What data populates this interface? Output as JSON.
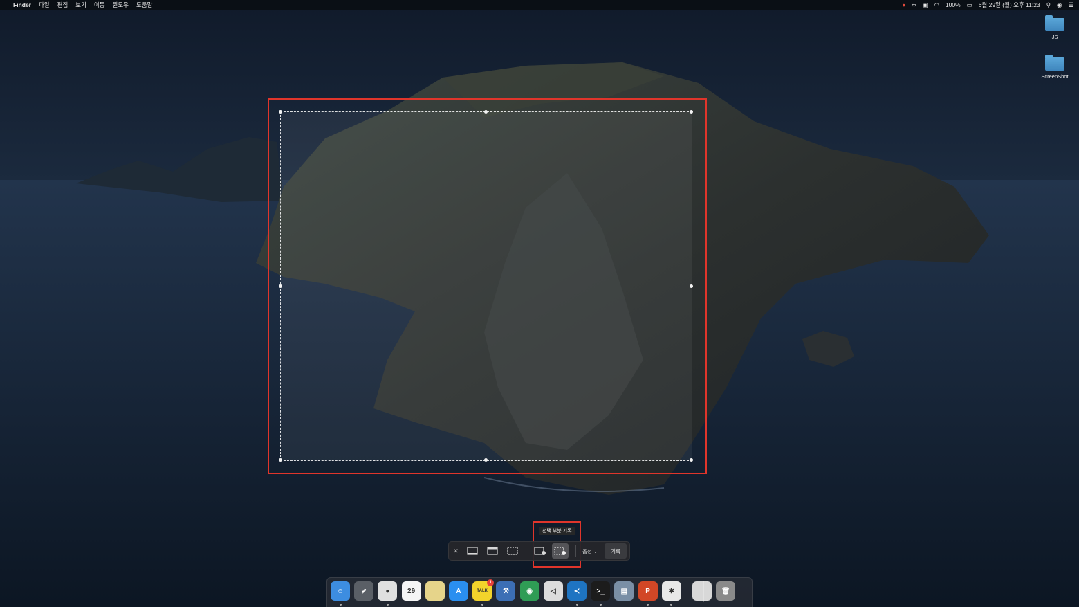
{
  "menubar": {
    "apple": "",
    "app_name": "Finder",
    "menus": [
      "파일",
      "편집",
      "보기",
      "이동",
      "윈도우",
      "도움말"
    ],
    "battery": "100%",
    "datetime": "6월 29일 (월) 오후 11:23"
  },
  "desktop": {
    "items": [
      {
        "label": "JS",
        "icon": "folder-icon"
      },
      {
        "label": "ScreenShot",
        "icon": "folder-icon"
      }
    ]
  },
  "capture_toolbar": {
    "tooltip": "선택 부분 기록",
    "options_label": "옵션",
    "record_label": "기록",
    "selected_mode": "record-selected-portion"
  },
  "dock": {
    "apps": [
      {
        "name": "finder",
        "glyph": "☺",
        "color": "#3d8de0"
      },
      {
        "name": "launchpad",
        "glyph": "➶",
        "color": "#5a5f66"
      },
      {
        "name": "chrome",
        "glyph": "●",
        "color": "#e0e0e0"
      },
      {
        "name": "calendar",
        "glyph": "29",
        "color": "#f5f5f5"
      },
      {
        "name": "notes",
        "glyph": "",
        "color": "#e6d48a"
      },
      {
        "name": "app-store",
        "glyph": "A",
        "color": "#2a8ff0"
      },
      {
        "name": "kakaotalk",
        "glyph": "TALK",
        "color": "#f2d32b",
        "badge": "1"
      },
      {
        "name": "xcode",
        "glyph": "⚒",
        "color": "#3c6fb5"
      },
      {
        "name": "sourcetree",
        "glyph": "◉",
        "color": "#2f9c55"
      },
      {
        "name": "unity",
        "glyph": "◁",
        "color": "#dcdcdc"
      },
      {
        "name": "vscode",
        "glyph": "≺",
        "color": "#1e74c2"
      },
      {
        "name": "terminal",
        "glyph": ">_",
        "color": "#1c1c1c"
      },
      {
        "name": "preview",
        "glyph": "▤",
        "color": "#7a8fa6"
      },
      {
        "name": "powerpoint",
        "glyph": "P",
        "color": "#d24726"
      },
      {
        "name": "slack",
        "glyph": "✱",
        "color": "#e8e8e8"
      },
      {
        "name": "documents",
        "glyph": "",
        "color": "#d8d8d8"
      },
      {
        "name": "trash",
        "glyph": "🗑",
        "color": "#8a8a8a"
      }
    ]
  }
}
